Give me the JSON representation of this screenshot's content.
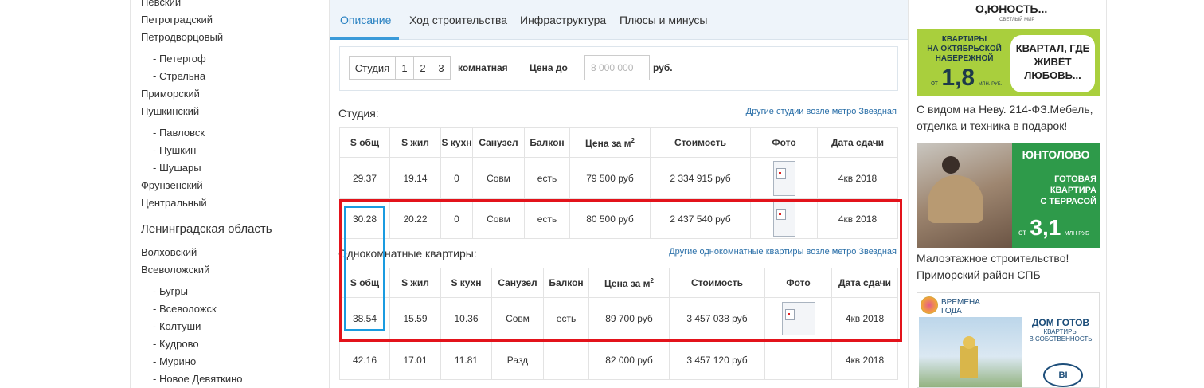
{
  "sidebar": {
    "items": [
      {
        "label": "Невский",
        "sub": false
      },
      {
        "label": "Петроградский",
        "sub": false
      },
      {
        "label": "Петродворцовый",
        "sub": false
      },
      {
        "label": "- Петергоф",
        "sub": true
      },
      {
        "label": "- Стрельна",
        "sub": true
      },
      {
        "label": "Приморский",
        "sub": false
      },
      {
        "label": "Пушкинский",
        "sub": false
      },
      {
        "label": "- Павловск",
        "sub": true
      },
      {
        "label": "- Пушкин",
        "sub": true
      },
      {
        "label": "- Шушары",
        "sub": true
      },
      {
        "label": "Фрунзенский",
        "sub": false
      },
      {
        "label": "Центральный",
        "sub": false
      }
    ],
    "region_heading": "Ленинградская область",
    "region_items": [
      {
        "label": "Волховский",
        "sub": false
      },
      {
        "label": "Всеволожский",
        "sub": false
      },
      {
        "label": "- Бугры",
        "sub": true
      },
      {
        "label": "- Всеволожск",
        "sub": true
      },
      {
        "label": "- Колтуши",
        "sub": true
      },
      {
        "label": "- Кудрово",
        "sub": true
      },
      {
        "label": "- Мурино",
        "sub": true
      },
      {
        "label": "- Новое Девяткино",
        "sub": true
      }
    ]
  },
  "tabs": [
    "Описание",
    "Ход строительства",
    "Инфраструктура",
    "Плюсы и минусы"
  ],
  "active_tab": "Описание",
  "filter": {
    "room_options": [
      "Студия",
      "1",
      "2",
      "3"
    ],
    "rooms_suffix": "комнатная",
    "price_label": "Цена до",
    "price_placeholder": "8 000 000",
    "currency": "руб."
  },
  "headers": {
    "s_total": "S общ",
    "s_living": "S жил",
    "s_kitchen": "S кухн",
    "bathroom": "Санузел",
    "balcony": "Балкон",
    "price_m2": "Цена за м",
    "price_m2_sup": "2",
    "cost": "Стоимость",
    "photo": "Фото",
    "delivery": "Дата сдачи"
  },
  "studio": {
    "title": "Студия:",
    "link": "Другие студии возле метро Звездная",
    "rows": [
      {
        "s_total": "29.37",
        "s_living": "19.14",
        "s_kitchen": "0",
        "bathroom": "Совм",
        "balcony": "есть",
        "price_m2": "79 500 руб",
        "cost": "2 334 915 руб",
        "delivery": "4кв 2018"
      },
      {
        "s_total": "30.28",
        "s_living": "20.22",
        "s_kitchen": "0",
        "bathroom": "Совм",
        "balcony": "есть",
        "price_m2": "80 500 руб",
        "cost": "2 437 540 руб",
        "delivery": "4кв 2018"
      }
    ]
  },
  "one_room": {
    "title": "Однокомнатные квартиры:",
    "link": "Другие однокомнатные квартиры возле метро Звездная",
    "rows": [
      {
        "s_total": "38.54",
        "s_living": "15.59",
        "s_kitchen": "10.36",
        "bathroom": "Совм",
        "balcony": "есть",
        "price_m2": "89 700 руб",
        "cost": "3 457 038 руб",
        "delivery": "4кв 2018"
      },
      {
        "s_total": "42.16",
        "s_living": "17.01",
        "s_kitchen": "11.81",
        "bathroom": "Разд",
        "balcony": "",
        "price_m2": "82 000 руб",
        "cost": "3 457 120 руб",
        "delivery": "4кв 2018"
      }
    ]
  },
  "ads": [
    {
      "brand": "О,ЮНОСТЬ...",
      "brand_sub": "СВЕТЛЫЙ МИР",
      "line1": "КВАРТИРЫ",
      "line2": "НА ОКТЯБРЬСКОЙ",
      "line3": "НАБЕРЕЖНОЙ",
      "from": "от",
      "price": "1,8",
      "price_unit": "МЛН. РУБ.",
      "slogan": "КВАРТАЛ, ГДЕ ЖИВЁТ ЛЮБОВЬ...",
      "caption": "С видом на Неву. 214-ФЗ.Мебель, отделка и техника в подарок!"
    },
    {
      "brand": "ЮНТОЛОВО",
      "line1": "ГОТОВАЯ",
      "line2": "КВАРТИРА",
      "line3": "С ТЕРРАСОЙ",
      "from": "от",
      "price": "3,1",
      "price_unit": "МЛН РУБ",
      "caption": "Малоэтажное строительство! Приморский район СПБ"
    },
    {
      "brand": "ВРЕМЕНА ГОДА",
      "line1": "ДОМ ГОТОВ",
      "line2": "КВАРТИРЫ",
      "line3": "В СОБСТВЕННОСТЬ",
      "logo": "BI GROUP"
    }
  ],
  "colors": {
    "link": "#2a6fa8",
    "active_tab": "#2a82c2",
    "highlight_red": "#e3131b",
    "highlight_blue": "#1a9be0",
    "ad_green": "#a9cf3d"
  }
}
